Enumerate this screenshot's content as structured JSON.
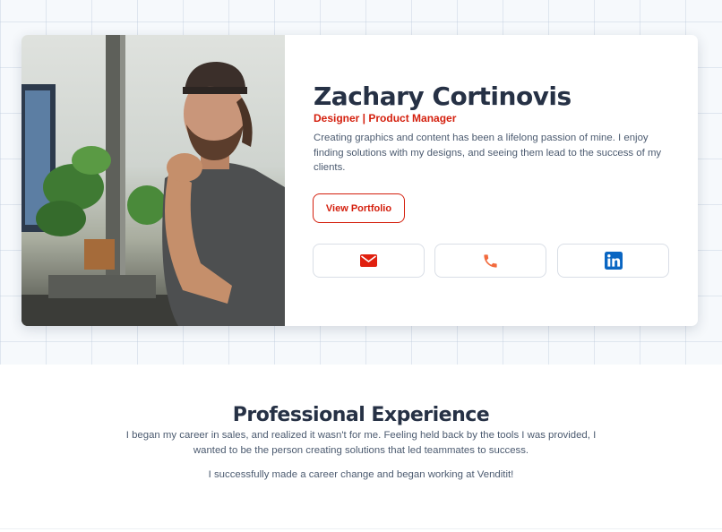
{
  "profile": {
    "name": "Zachary Cortinovis",
    "role": "Designer | Product Manager",
    "bio": "Creating graphics and content has been a lifelong passion of mine. I enjoy finding solutions with my designs, and seeing them lead to the success of my clients.",
    "portfolio_label": "View Portfolio"
  },
  "contacts": [
    {
      "icon": "envelope-icon",
      "color": "#e0200f"
    },
    {
      "icon": "phone-icon",
      "color": "#f26a3d"
    },
    {
      "icon": "linkedin-icon",
      "color": "#0a66c2"
    }
  ],
  "experience": {
    "title": "Professional Experience",
    "paragraph1": "I began my career in sales, and realized it wasn't for me. Feeling held back by the tools I was provided, I wanted to be the person creating solutions that led teammates to success.",
    "paragraph2": "I successfully made a career change and began working at Venditit!"
  },
  "colors": {
    "accent": "#d41f0d",
    "heading": "#263145",
    "body_text": "#4c5b70",
    "hero_background": "#f6f9fc"
  }
}
